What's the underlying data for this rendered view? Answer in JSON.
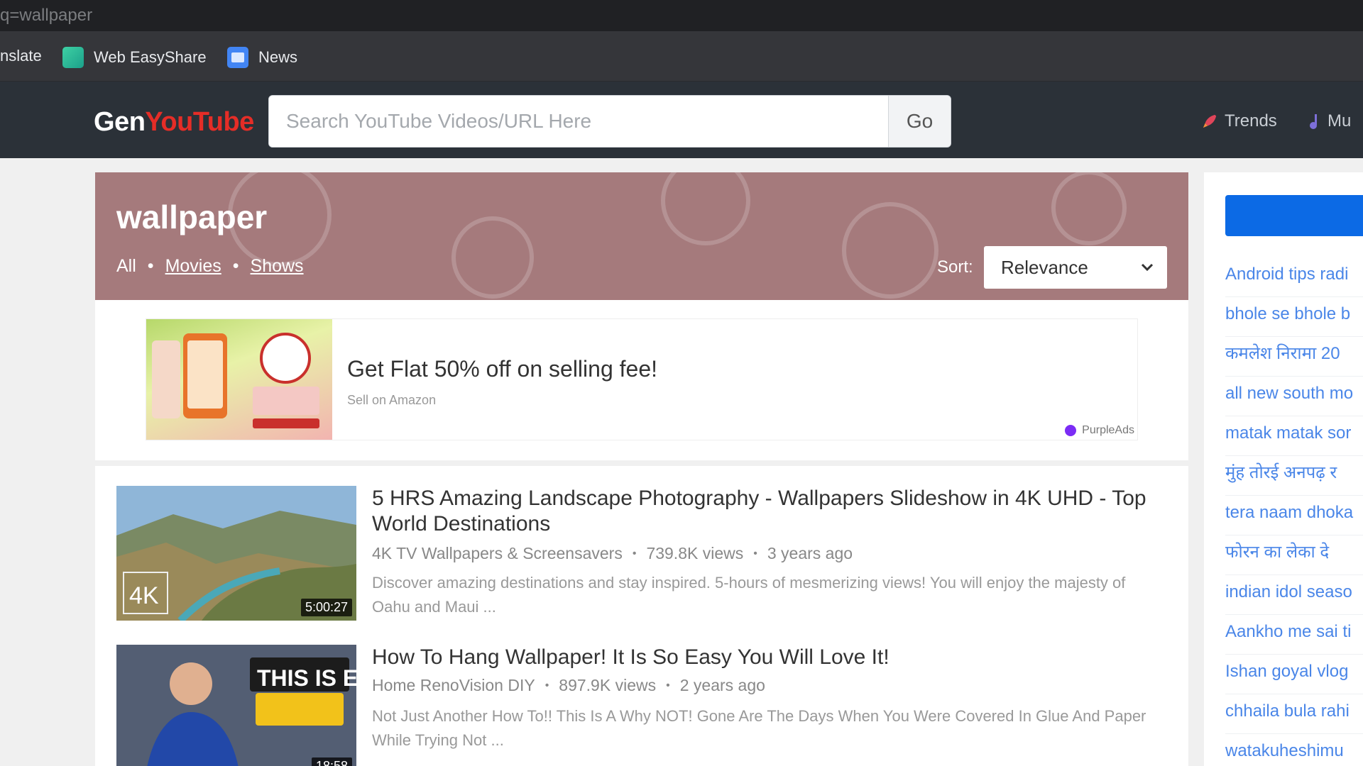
{
  "browser": {
    "url_fragment": "q=wallpaper",
    "bookmarks": [
      {
        "label": "nslate"
      },
      {
        "label": "Web EasyShare"
      },
      {
        "label": "News"
      }
    ]
  },
  "header": {
    "logo_gen": "Gen",
    "logo_yt": "YouTube",
    "search_placeholder": "Search YouTube Videos/URL Here",
    "search_button": "Go",
    "nav": [
      {
        "label": "Trends",
        "icon": "rocket-icon"
      },
      {
        "label": "Mu",
        "icon": "music-note-icon"
      }
    ]
  },
  "hero": {
    "query": "wallpaper",
    "filters": [
      {
        "label": "All"
      },
      {
        "label": "Movies"
      },
      {
        "label": "Shows"
      }
    ],
    "sort_label": "Sort:",
    "sort_value": "Relevance"
  },
  "ad": {
    "title": "Get Flat 50% off on selling fee!",
    "subtitle": "Sell on Amazon",
    "brand": "PurpleAds"
  },
  "results": [
    {
      "title": "5 HRS Amazing Landscape Photography - Wallpapers Slideshow in 4K UHD - Top World Destinations",
      "channel": "4K TV Wallpapers & Screensavers",
      "views": "739.8K views",
      "age": "3 years ago",
      "description": "Discover amazing destinations and stay inspired. 5-hours of mesmerizing views! You will enjoy the majesty of Oahu and Maui ...",
      "duration": "5:00:27",
      "badge": "4K"
    },
    {
      "title": "How To Hang Wallpaper! It Is So Easy You Will Love It!",
      "channel": "Home RenoVision DIY",
      "views": "897.9K views",
      "age": "2 years ago",
      "description": "Not Just Another How To!! This Is A Why NOT! Gone Are The Days When You Were Covered In Glue And Paper While Trying Not ...",
      "duration": "18:58",
      "badge": "THIS IS EASY!!"
    }
  ],
  "sidebar": {
    "links": [
      "Android tips radi",
      "bhole se bhole b",
      "कमलेश निरामा 20",
      "all new south mo",
      "matak matak sor",
      "मुंह तोरई अनपढ़ र",
      "tera naam dhoka",
      "फोरन का लेका दे",
      "indian idol seaso",
      "Aankho me sai ti",
      "Ishan goyal vlog",
      "chhaila bula rahi",
      "watakuheshimu"
    ]
  },
  "colors": {
    "header_bg": "#2b3138",
    "hero_bg": "#a57a7c",
    "logo_red": "#e52d27",
    "link_blue": "#4a86e8",
    "sidebar_button": "#0c6ae5"
  }
}
